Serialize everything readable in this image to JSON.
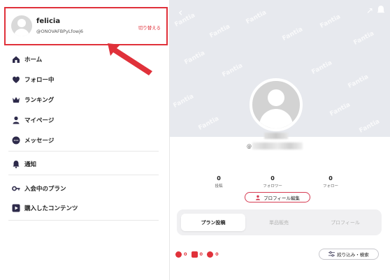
{
  "account": {
    "name": "felicia",
    "handle": "@ONOVAFBPyLfowj6",
    "switch_label": "切り替える"
  },
  "menu": {
    "items": [
      {
        "label": "ホーム",
        "icon": "home-icon"
      },
      {
        "label": "フォロー中",
        "icon": "heart-icon"
      },
      {
        "label": "ランキング",
        "icon": "crown-icon"
      },
      {
        "label": "マイページ",
        "icon": "person-icon"
      },
      {
        "label": "メッセージ",
        "icon": "message-icon"
      },
      {
        "label": "通知",
        "icon": "bell-icon"
      },
      {
        "label": "入会中のプラン",
        "icon": "key-icon"
      },
      {
        "label": "購入したコンテンツ",
        "icon": "play-icon"
      }
    ]
  },
  "profile": {
    "handle_prefix": "@",
    "stats": [
      {
        "value": "0",
        "label": "投稿"
      },
      {
        "value": "0",
        "label": "フォロワー"
      },
      {
        "value": "0",
        "label": "フォロー"
      }
    ],
    "edit_label": "プロフィール編集",
    "tabs": [
      {
        "label": "プラン投稿",
        "active": true
      },
      {
        "label": "単品販売",
        "active": false
      },
      {
        "label": "プロフィール",
        "active": false
      }
    ],
    "counters": [
      {
        "value": "0",
        "icon": "video-icon"
      },
      {
        "value": "0",
        "icon": "image-icon"
      },
      {
        "value": "0",
        "icon": "text-icon"
      }
    ],
    "filter_label": "絞り込み・検索",
    "watermark": "Fantia"
  },
  "colors": {
    "accent": "#e0313a",
    "icon": "#2d2a4a",
    "cover": "#e7e9ee"
  }
}
